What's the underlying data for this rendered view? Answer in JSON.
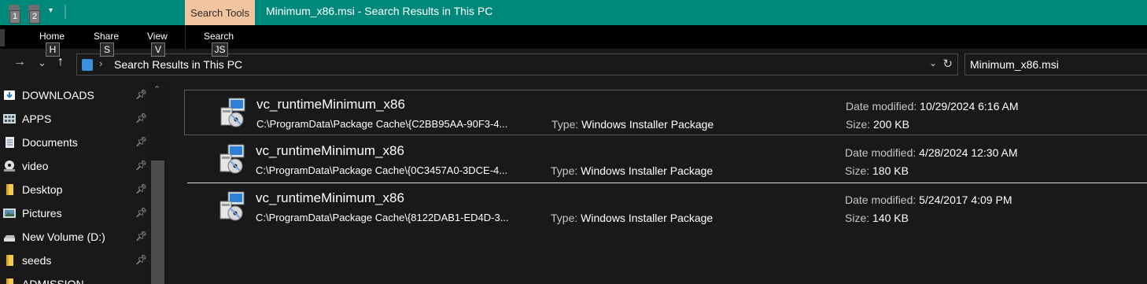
{
  "quick_access": {
    "keys": [
      "1",
      "2"
    ]
  },
  "search_tools_tab": "Search Tools",
  "window_title": "Minimum_x86.msi - Search Results in This PC",
  "ribbon": {
    "tabs": [
      {
        "label": "Home",
        "key": "H"
      },
      {
        "label": "Share",
        "key": "S"
      },
      {
        "label": "View",
        "key": "V"
      },
      {
        "label": "Search",
        "key": "JS"
      }
    ]
  },
  "nav": {
    "back_icon": "arrow-right-icon",
    "recent_icon": "chevron-down-icon",
    "up_icon": "arrow-up-icon"
  },
  "address": {
    "path": "Search Results in This PC"
  },
  "search": {
    "value": "Minimum_x86.msi"
  },
  "sidebar": {
    "items": [
      {
        "label": "DOWNLOADS",
        "icon": "download-icon"
      },
      {
        "label": "APPS",
        "icon": "apps-icon"
      },
      {
        "label": "Documents",
        "icon": "document-icon"
      },
      {
        "label": "video",
        "icon": "video-disc-icon"
      },
      {
        "label": "Desktop",
        "icon": "folder-icon"
      },
      {
        "label": "Pictures",
        "icon": "pictures-icon"
      },
      {
        "label": "New Volume (D:)",
        "icon": "drive-icon"
      },
      {
        "label": "seeds",
        "icon": "folder-icon"
      },
      {
        "label": "ADMISSION",
        "icon": "folder-icon"
      }
    ]
  },
  "results": [
    {
      "name": "vc_runtimeMinimum_x86",
      "path": "C:\\ProgramData\\Package Cache\\{C2BB95AA-90F3-4...",
      "type_caption": "Type:",
      "type": "Windows Installer Package",
      "date_caption": "Date modified:",
      "date": "10/29/2024 6:16 AM",
      "size_caption": "Size:",
      "size": "200 KB"
    },
    {
      "name": "vc_runtimeMinimum_x86",
      "path": "C:\\ProgramData\\Package Cache\\{0C3457A0-3DCE-4...",
      "type_caption": "Type:",
      "type": "Windows Installer Package",
      "date_caption": "Date modified:",
      "date": "4/28/2024 12:30 AM",
      "size_caption": "Size:",
      "size": "180 KB"
    },
    {
      "name": "vc_runtimeMinimum_x86",
      "path": "C:\\ProgramData\\Package Cache\\{8122DAB1-ED4D-3...",
      "type_caption": "Type:",
      "type": "Windows Installer Package",
      "date_caption": "Date modified:",
      "date": "5/24/2017 4:09 PM",
      "size_caption": "Size:",
      "size": "140 KB"
    }
  ],
  "colors": {
    "titlebar": "#00897b",
    "search_tools_tab": "#f3c59f",
    "background": "#191919",
    "ribbon": "#000000"
  }
}
